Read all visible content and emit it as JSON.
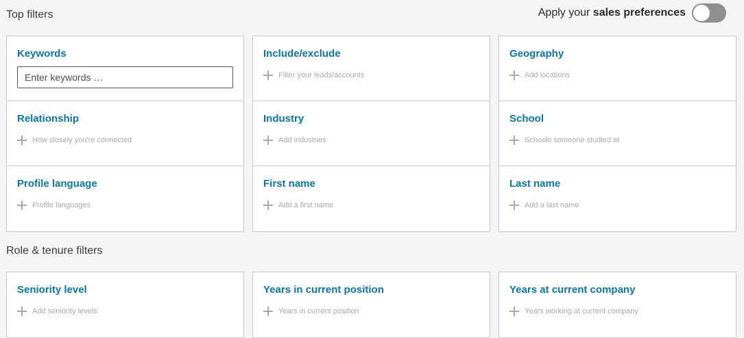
{
  "top_filters": {
    "title": "Top filters",
    "columns": [
      [
        {
          "title": "Keywords",
          "input_placeholder": "Enter keywords …"
        },
        {
          "title": "Relationship",
          "hint": "How closely you're connected"
        },
        {
          "title": "Profile language",
          "hint": "Profile languages"
        }
      ],
      [
        {
          "title": "Include/exclude",
          "hint": "Filter your leads/accounts"
        },
        {
          "title": "Industry",
          "hint": "Add industries"
        },
        {
          "title": "First name",
          "hint": "Add a first name"
        }
      ],
      [
        {
          "title": "Geography",
          "hint": "Add locations"
        },
        {
          "title": "School",
          "hint": "Schools someone studied at"
        },
        {
          "title": "Last name",
          "hint": "Add a last name"
        }
      ]
    ]
  },
  "preferences": {
    "prefix": "Apply your",
    "bold": "sales preferences",
    "toggle_on": false
  },
  "role_filters": {
    "title": "Role & tenure filters",
    "items": [
      {
        "title": "Seniority level",
        "hint": "Add seniority levels"
      },
      {
        "title": "Years in current position",
        "hint": "Years in current position"
      },
      {
        "title": "Years at current company",
        "hint": "Years working at current company"
      }
    ]
  },
  "colors": {
    "accent": "#0a77a8",
    "toggle_off": "#8f8f8f",
    "background": "#f3f4f6"
  }
}
